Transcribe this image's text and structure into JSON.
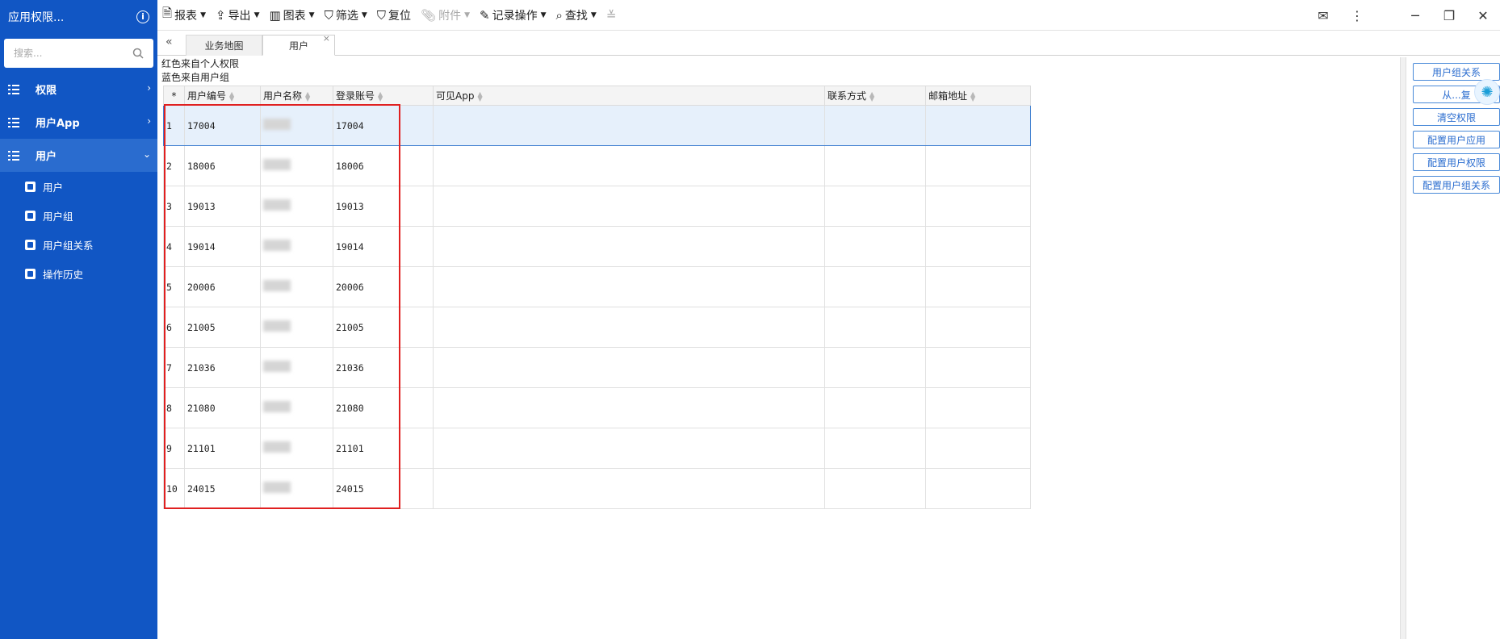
{
  "sidebar": {
    "title": "应用权限...",
    "search_placeholder": "搜索...",
    "groups": [
      {
        "label": "权限",
        "chevron": "›"
      },
      {
        "label": "用户App",
        "chevron": "›"
      },
      {
        "label": "用户",
        "chevron": "⌄"
      }
    ],
    "items": [
      {
        "label": "用户"
      },
      {
        "label": "用户组"
      },
      {
        "label": "用户组关系"
      },
      {
        "label": "操作历史"
      }
    ]
  },
  "toolbar": {
    "buttons": [
      {
        "label": "报表",
        "icon": "report-icon"
      },
      {
        "label": "导出",
        "icon": "export-icon"
      },
      {
        "label": "图表",
        "icon": "chart-icon"
      },
      {
        "label": "筛选",
        "icon": "filter-icon"
      },
      {
        "label": "复位",
        "icon": "reset-filter-icon"
      },
      {
        "label": "附件",
        "icon": "attachment-icon"
      },
      {
        "label": "记录操作",
        "icon": "edit-record-icon"
      },
      {
        "label": "查找",
        "icon": "search-icon"
      }
    ]
  },
  "tabs": [
    {
      "label": "业务地图"
    },
    {
      "label": "用户"
    }
  ],
  "legend": {
    "line1": "红色来自个人权限",
    "line2": "蓝色来自用户组"
  },
  "table": {
    "columns": [
      "*",
      "用户编号",
      "用户名称",
      "登录账号",
      "可见App",
      "联系方式",
      "邮箱地址"
    ],
    "rows": [
      {
        "n": "1",
        "id": "17004",
        "login": "17004"
      },
      {
        "n": "2",
        "id": "18006",
        "login": "18006"
      },
      {
        "n": "3",
        "id": "19013",
        "login": "19013"
      },
      {
        "n": "4",
        "id": "19014",
        "login": "19014"
      },
      {
        "n": "5",
        "id": "20006",
        "login": "20006"
      },
      {
        "n": "6",
        "id": "21005",
        "login": "21005"
      },
      {
        "n": "7",
        "id": "21036",
        "login": "21036"
      },
      {
        "n": "8",
        "id": "21080",
        "login": "21080"
      },
      {
        "n": "9",
        "id": "21101",
        "login": "21101"
      },
      {
        "n": "10",
        "id": "24015",
        "login": "24015"
      }
    ]
  },
  "right_panel": {
    "buttons": [
      "用户组关系",
      "从...复",
      "清空权限",
      "配置用户应用",
      "配置用户权限",
      "配置用户组关系"
    ]
  }
}
